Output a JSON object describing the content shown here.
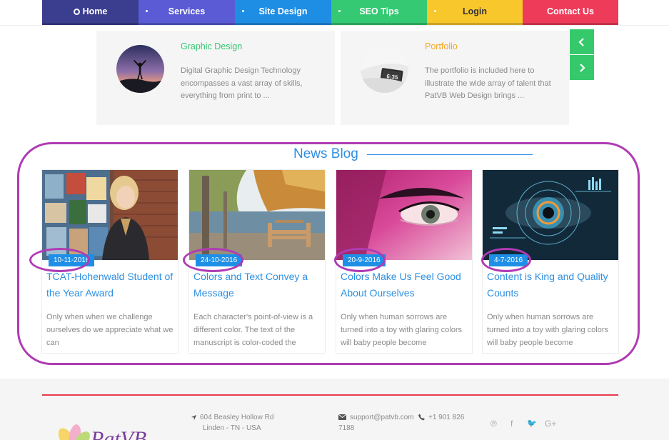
{
  "nav": {
    "items": [
      {
        "label": "Home",
        "color": "#3b3e8f",
        "icon": "home-icon"
      },
      {
        "label": "Services",
        "color": "#5b5bd6"
      },
      {
        "label": "Site Design",
        "color": "#1e8ee4"
      },
      {
        "label": "SEO Tips",
        "color": "#34c972"
      },
      {
        "label": "Login",
        "color": "#f8c72c"
      },
      {
        "label": "Contact Us",
        "color": "#ee3b59"
      }
    ]
  },
  "services": [
    {
      "title": "Graphic Design",
      "text": "Digital Graphic Design Technology encompasses a vast array of skills, everything from print to ...",
      "title_color": "#34c972"
    },
    {
      "title": "Portfolio",
      "text": "The portfolio is included here to illustrate the wide array of talent that PatVB Web Design brings ...",
      "title_color": "#f5a623",
      "image_text": "6:35"
    }
  ],
  "carousel": {
    "prev_icon": "chevron-left-icon",
    "next_icon": "chevron-right-icon"
  },
  "blog": {
    "heading": "News Blog",
    "posts": [
      {
        "date": "10-11-2016",
        "title": "TCAT-Hohenwald Student of the Year Award",
        "excerpt": "Only when when we challenge ourselves do we appreciate what we can"
      },
      {
        "date": "24-10-2016",
        "title": "Colors and Text Convey a Message",
        "excerpt": "Each character's point-of-view is a different color. The text of the manuscript is color-coded the"
      },
      {
        "date": "20-9-2016",
        "title": "Colors Make Us Feel Good About Ourselves",
        "excerpt": "Only when human sorrows are turned into a toy with glaring colors will baby people become"
      },
      {
        "date": "4-7-2016",
        "title": "Content is King and Quality Counts",
        "excerpt": "Only when human sorrows are turned into a toy with glaring colors will baby people become"
      }
    ]
  },
  "footer": {
    "address_line1": "604 Beasley Hollow Rd",
    "address_line2": "Linden - TN - USA",
    "email": "support@patvb.com",
    "phone": "+1 901 826 7188",
    "logo_text": "PatVB",
    "social_icons": [
      "pinterest-icon",
      "facebook-icon",
      "twitter-icon",
      "google-plus-icon"
    ],
    "social_glyphs": [
      "℗",
      "f",
      "🐦",
      "G+"
    ]
  },
  "accent_colors": {
    "highlight": "#b03bb4",
    "blue": "#2d8fe2",
    "green": "#35c96c",
    "red": "#e83a4d"
  }
}
